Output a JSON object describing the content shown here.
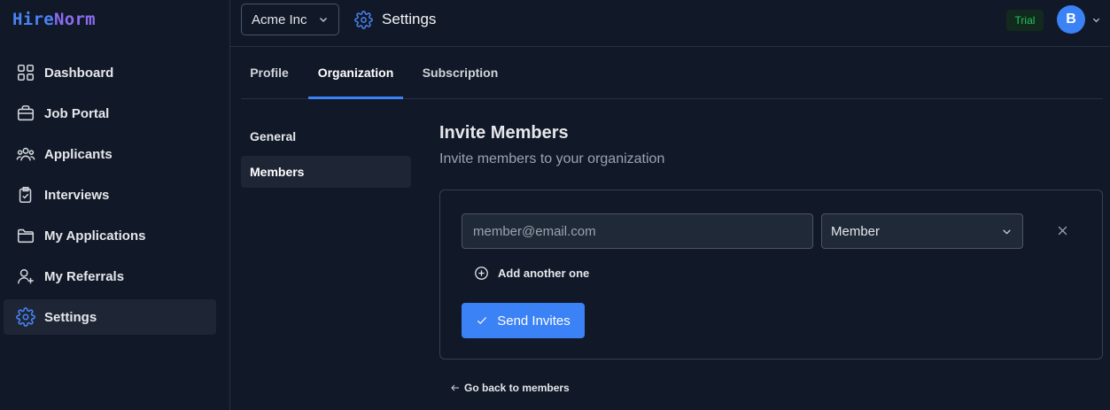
{
  "app": {
    "logo_part1": "Hire",
    "logo_part2": "Norm"
  },
  "sidebar": {
    "items": [
      {
        "label": "Dashboard",
        "icon": "dashboard-grid-icon"
      },
      {
        "label": "Job Portal",
        "icon": "briefcase-icon"
      },
      {
        "label": "Applicants",
        "icon": "users-icon"
      },
      {
        "label": "Interviews",
        "icon": "clipboard-check-icon"
      },
      {
        "label": "My Applications",
        "icon": "folder-icon"
      },
      {
        "label": "My Referrals",
        "icon": "user-plus-icon"
      },
      {
        "label": "Settings",
        "icon": "gear-icon",
        "active": true
      }
    ]
  },
  "header": {
    "org_name": "Acme Inc",
    "title": "Settings",
    "trial_badge": "Trial",
    "avatar_initial": "B"
  },
  "tabs": [
    {
      "label": "Profile"
    },
    {
      "label": "Organization",
      "active": true
    },
    {
      "label": "Subscription"
    }
  ],
  "subnav": [
    {
      "label": "General"
    },
    {
      "label": "Members",
      "active": true
    }
  ],
  "invite": {
    "title": "Invite Members",
    "subtitle": "Invite members to your organization",
    "email_placeholder": "member@email.com",
    "email_value": "",
    "role_value": "Member",
    "add_another": "Add another one",
    "send_label": "Send Invites",
    "back_label": "Go back to members"
  },
  "colors": {
    "background": "#111827",
    "accent": "#3b82f6",
    "trial_green": "#22c55e"
  }
}
